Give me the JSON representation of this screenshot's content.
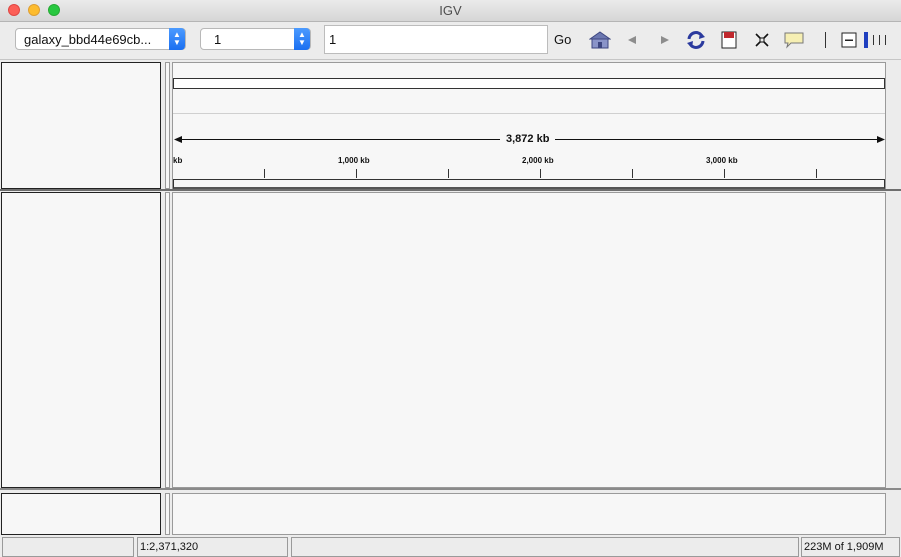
{
  "window": {
    "title": "IGV"
  },
  "toolbar": {
    "genome_select": "galaxy_bbd44e69cb...",
    "chromosome_select": "1",
    "locus_value": "1",
    "go_label": "Go",
    "icons": [
      "home-icon",
      "back-icon",
      "forward-icon",
      "refresh-icon",
      "roi-icon",
      "fit-window-icon",
      "popup-info-icon",
      "zoom-out-icon",
      "zoom-level-icon"
    ]
  },
  "ruler": {
    "span_label": "3,872 kb",
    "start_label": "kb",
    "tick_labels": [
      "1,000 kb",
      "2,000 kb",
      "3,000 kb"
    ]
  },
  "status": {
    "message": "",
    "position": "1:2,371,320",
    "info": "",
    "memory": "223M of 1,909M"
  },
  "colors": {
    "selection_blue": "#1a6ff1",
    "zoom_bar": "#1f3fbf"
  }
}
